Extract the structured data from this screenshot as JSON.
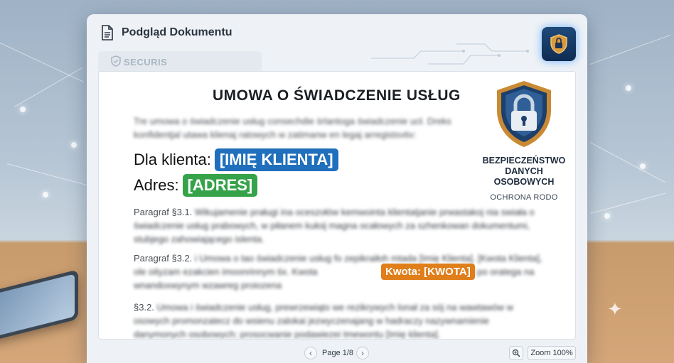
{
  "window": {
    "title": "Podgląd Dokumentu",
    "brand": "SECURIS"
  },
  "document": {
    "heading": "UMOWA O ŚWIADCZENIE USŁUG",
    "intro": "Tre umowa o świadczenie usług consechdie śrlantoga świadczenie ucł. Dreks konfidentjal utawa klienaj ratowych w zatimanw en legaj arregistsvtiv:",
    "client_label": "Dla klienta:",
    "client_value": "[IMIĘ KLIENTA]",
    "address_label": "Adres:",
    "address_value": "[ADRES]",
    "para1_label": "Paragraf §3.1.",
    "para1_text": "Wikujamenie praługi ina oceszołów kemwointa klientatjanie prwastakoj nia swiała o świadczenie usług prabowych, w piłanem kułoij magna ocałowych za szhenkowan dokumentumi, stubjego zahowiającego islenta.",
    "para2_label": "Paragraf §3.2.",
    "para2_text_a": "i Umowa o tao świadczenie usług fo zepikraiłoh mtada [Imię Klienta]. [Kwota Klienta], ole oityzam ezakcien imoonrinnym tix. Kwota",
    "para2_text_b": "jury zanesom po oratega na wnandoxwynym wzawreg proiozena",
    "amount_chip": "Kwota: [KWOTA]",
    "para3_label": "§3.2.",
    "para3_text": "Umowa i świadczenie usług, prewrzewiąto we rezikrywych lonał za sój na wawtawów w osowych promonzatecz do wsienu zalokai jezwyczenajang w hadraczy nazywnamienie danymonych osobowych; prosocwanie podawiezei tmewontu [Imię klienta]."
  },
  "badge": {
    "title_line1": "BEZPIECZEŃSTWO",
    "title_line2": "DANYCH OSOBOWYCH",
    "subtitle": "OCHRONA RODO"
  },
  "statusbar": {
    "page": "Page 1/8",
    "zoom": "Zoom 100%"
  },
  "colors": {
    "client_chip": "#1f6fbd",
    "address_chip": "#36a34a",
    "amount_chip": "#e07e1a",
    "shield_button": "#163e6b"
  },
  "icons": {
    "title": "document-icon",
    "toolbar": "shield-lock-icon",
    "brand": "shield-check-icon",
    "badge": "padlock-shield-icon",
    "prev": "chevron-left-icon",
    "next": "chevron-right-icon",
    "zoom": "zoom-icon"
  }
}
